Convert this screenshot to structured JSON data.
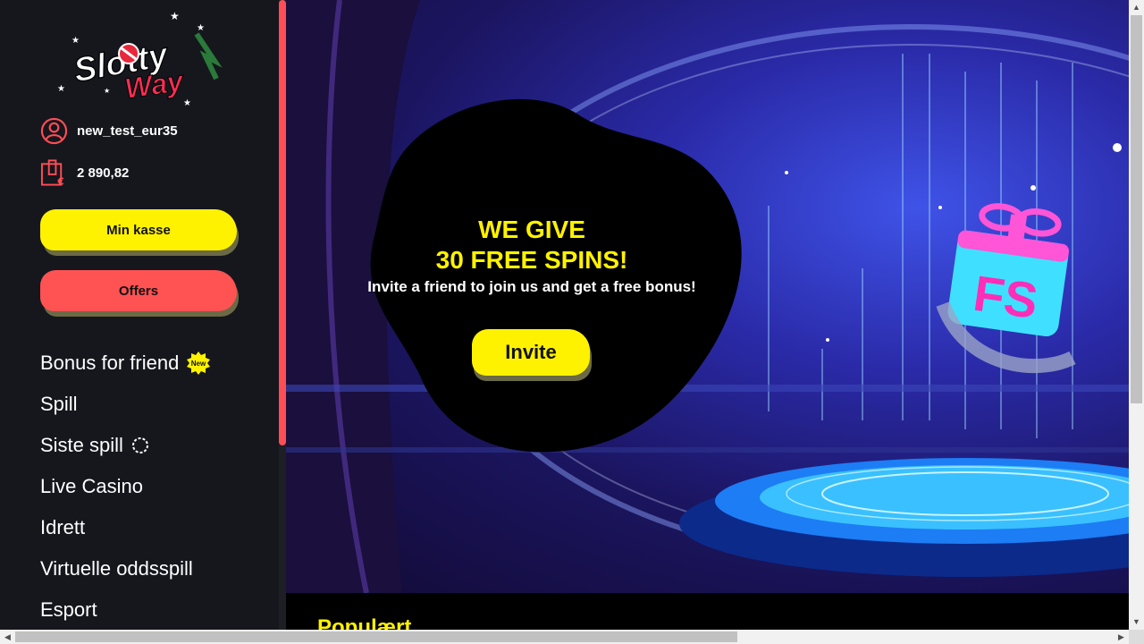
{
  "brand": {
    "logo_text_top": "Slotty",
    "logo_text_bottom": "Way"
  },
  "user": {
    "username": "new_test_eur35",
    "balance": "2 890,82"
  },
  "sidebar": {
    "cashier_label": "Min kasse",
    "offers_label": "Offers",
    "new_badge": "New",
    "items": [
      {
        "label": "Bonus for friend"
      },
      {
        "label": "Spill"
      },
      {
        "label": "Siste spill"
      },
      {
        "label": "Live Casino"
      },
      {
        "label": "Idrett"
      },
      {
        "label": "Virtuelle oddsspill"
      },
      {
        "label": "Esport"
      }
    ]
  },
  "hero": {
    "line1": "WE GIVE",
    "line2": "30 FREE SPINS!",
    "subtitle": "Invite a friend to join us and get a free bonus!",
    "invite_label": "Invite",
    "gift_text": "FS"
  },
  "main": {
    "section_title": "Populært"
  },
  "colors": {
    "accent_yellow": "#fff200",
    "accent_red": "#ff5253",
    "sidebar_bg": "#15171d"
  }
}
